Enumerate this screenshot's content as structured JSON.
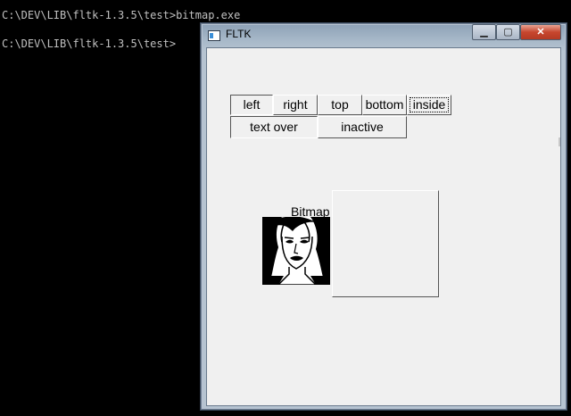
{
  "console": {
    "line1": "C:\\DEV\\LIB\\fltk-1.3.5\\test>bitmap.exe",
    "line2": "C:\\DEV\\LIB\\fltk-1.3.5\\test>"
  },
  "window": {
    "title": "FLTK",
    "minimize_glyph": "▁",
    "maximize_glyph": "▢",
    "close_glyph": "✕"
  },
  "buttons": {
    "left": "left",
    "right": "right",
    "top": "top",
    "bottom": "bottom",
    "inside": "inside",
    "text_over": "text over",
    "inactive": "inactive"
  },
  "states": {
    "left": "pressed",
    "text_over": "pressed",
    "inside": "focused"
  },
  "bitmap_button": {
    "label": "Bitmap",
    "image": "woman-portrait-bitmap"
  },
  "colors": {
    "console_bg": "#000000",
    "window_bg": "#f0f0f0",
    "close_button": "#c7462e"
  }
}
